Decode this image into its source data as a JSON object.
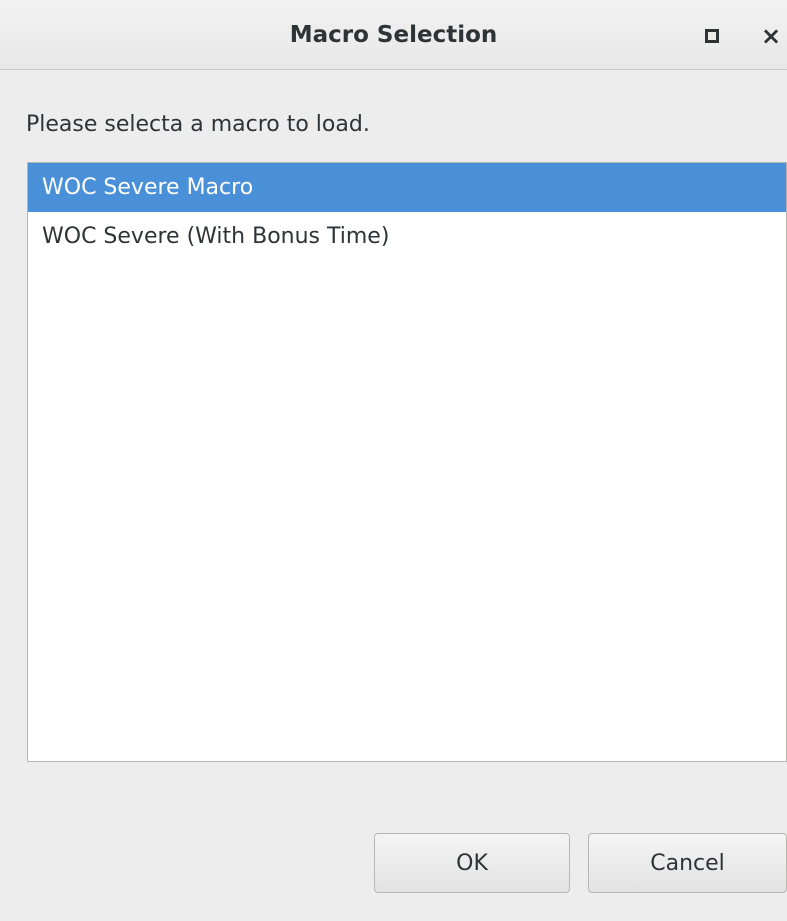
{
  "window": {
    "title": "Macro Selection",
    "maximize_icon": "maximize-icon",
    "close_icon": "close-icon",
    "close_glyph": "×"
  },
  "prompt": "Please selecta a macro to load.",
  "macros": {
    "items": [
      {
        "label": "WOC Severe Macro",
        "selected": true
      },
      {
        "label": "WOC Severe (With Bonus Time)",
        "selected": false
      }
    ]
  },
  "buttons": {
    "ok_label": "OK",
    "cancel_label": "Cancel"
  },
  "colors": {
    "selection": "#4a90d9",
    "window_bg": "#ededed"
  }
}
